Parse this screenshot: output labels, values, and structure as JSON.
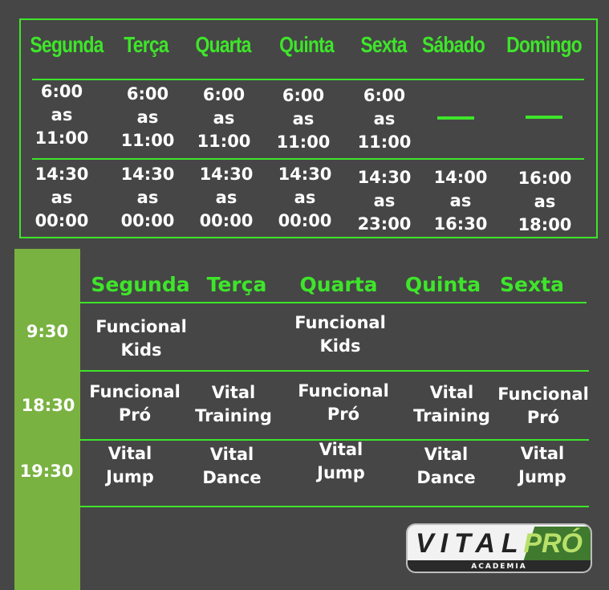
{
  "hours": {
    "days": [
      "Segunda",
      "Terça",
      "Quarta",
      "Quinta",
      "Sexta",
      "Sábado",
      "Domingo"
    ],
    "morning": [
      "6:00\nas\n11:00",
      "6:00\nas\n11:00",
      "6:00\nas\n11:00",
      "6:00\nas\n11:00",
      "6:00\nas\n11:00"
    ],
    "evening": [
      "14:30\nas\n00:00",
      "14:30\nas\n00:00",
      "14:30\nas\n00:00",
      "14:30\nas\n00:00",
      "14:30\nas\n23:00",
      "14:00\nas\n16:30",
      "16:00\nas\n18:00"
    ]
  },
  "classes": {
    "days": [
      "Segunda",
      "Terça",
      "Quarta",
      "Quinta",
      "Sexta"
    ],
    "times": [
      "9:30",
      "18:30",
      "19:30"
    ],
    "row1": [
      "Funcional\nKids",
      "Funcional\nKids"
    ],
    "row2": [
      "Funcional\nPró",
      "Vital\nTraining",
      "Funcional\nPró",
      "Vital\nTraining",
      "Funcional\nPró"
    ],
    "row3": [
      "Vital\nJump",
      "Vital\nDance",
      "Vital\nJump",
      "Vital\nDance",
      "Vital\nJump"
    ]
  },
  "logo": {
    "text": "VITAL PRÓ ACADEMIA"
  },
  "colors": {
    "accent": "#3ee52a",
    "sidebar": "#79b241",
    "background": "#464646"
  }
}
